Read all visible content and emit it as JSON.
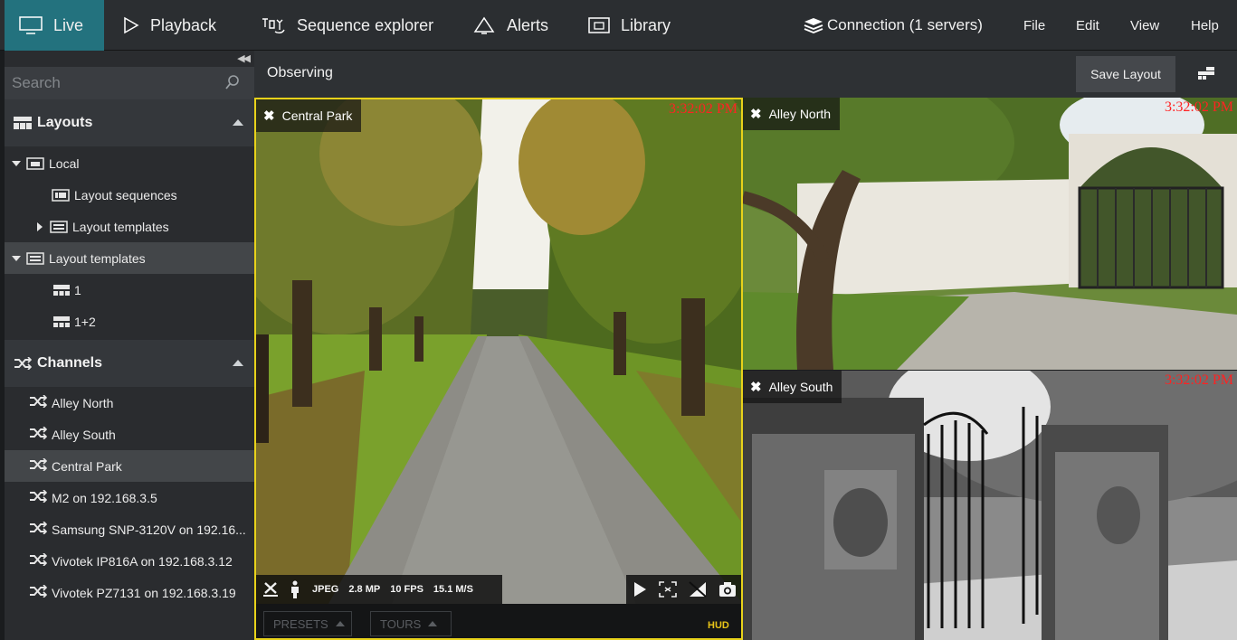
{
  "topbar": {
    "tabs": [
      {
        "label": "Live",
        "icon": "monitor-icon",
        "active": true
      },
      {
        "label": "Playback",
        "icon": "play-icon"
      },
      {
        "label": "Sequence explorer",
        "icon": "sequence-icon"
      },
      {
        "label": "Alerts",
        "icon": "bell-icon"
      },
      {
        "label": "Library",
        "icon": "library-icon"
      }
    ],
    "connection": "Connection (1 servers)",
    "menu": [
      "File",
      "Edit",
      "View",
      "Help"
    ]
  },
  "sidebar": {
    "search_placeholder": "Search",
    "layouts_header": "Layouts",
    "layout_items": [
      {
        "label": "Local"
      },
      {
        "label": "Layout sequences"
      },
      {
        "label": "Layout templates"
      },
      {
        "label": "Layout templates"
      },
      {
        "label": "1"
      },
      {
        "label": "1+2"
      }
    ],
    "channels_header": "Channels",
    "channels": [
      {
        "label": "Alley North"
      },
      {
        "label": "Alley South"
      },
      {
        "label": "Central Park",
        "selected": true
      },
      {
        "label": "M2 on 192.168.3.5"
      },
      {
        "label": "Samsung SNP-3120V on 192.16..."
      },
      {
        "label": "Vivotek IP816A on 192.168.3.12"
      },
      {
        "label": "Vivotek PZ7131 on 192.168.3.19"
      }
    ]
  },
  "main": {
    "title": "Observing",
    "save_layout": "Save Layout",
    "panes": [
      {
        "title": "Central Park",
        "timestamp": "3:32:02 PM"
      },
      {
        "title": "Alley North",
        "timestamp": "3:32:02 PM"
      },
      {
        "title": "Alley South",
        "timestamp": "3:32:02 PM"
      }
    ],
    "stats": {
      "codec": "JPEG",
      "resolution": "2.8 MP",
      "fps": "10 FPS",
      "bitrate": "15.1 M/S"
    },
    "footer": {
      "presets": "PRESETS",
      "tours": "TOURS",
      "hud": "HUD"
    }
  },
  "colors": {
    "accent": "#23727e",
    "selection_border": "#e8d21a",
    "timestamp": "#ff2222"
  }
}
